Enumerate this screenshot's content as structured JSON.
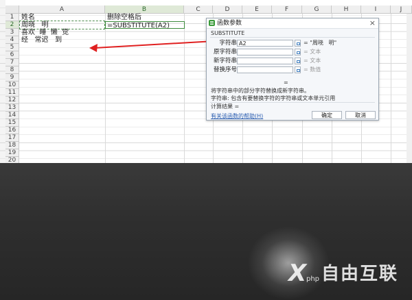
{
  "columns": [
    "A",
    "B",
    "C",
    "D",
    "E",
    "F",
    "G",
    "H",
    "I",
    "J"
  ],
  "rows": [
    "1",
    "2",
    "3",
    "4",
    "5",
    "6",
    "7",
    "8",
    "9",
    "10",
    "11",
    "12",
    "13",
    "14",
    "15",
    "16",
    "17",
    "18",
    "19",
    "20"
  ],
  "cells": {
    "A1": "姓名",
    "B1": "删除空格后",
    "A2": "周晓   明",
    "B2": "=SUBSTITUTE(A2)",
    "A3": "喜欢  睡  懒  觉",
    "A4": "经   常迟   到"
  },
  "dialog": {
    "title": "函数参数",
    "close": "×",
    "function_name": "SUBSTITUTE",
    "params": [
      {
        "label": "字符串",
        "value": "A2",
        "result": "= \"周晓   明\""
      },
      {
        "label": "原字符串",
        "value": "",
        "result": "= 文本"
      },
      {
        "label": "新字符串",
        "value": "",
        "result": "= 文本"
      },
      {
        "label": "替换序号",
        "value": "",
        "result": "= 数值"
      }
    ],
    "equals": "=",
    "description": "将字符串中的部分字符替换成新字符串。",
    "arg_description": "字符串: 包含有要替换字符的字符串或文本单元引用",
    "calc_result": "计算结果 =",
    "help_link": "有关该函数的帮助(H)",
    "ok": "确定",
    "cancel": "取消"
  },
  "watermark": {
    "mark": "X",
    "php": "php",
    "text": "自由互联"
  },
  "colors": {
    "selected_header": "#dfe9d7",
    "accent_green": "#3a9a3a",
    "arrow": "#e02020",
    "link": "#2a5db0"
  }
}
